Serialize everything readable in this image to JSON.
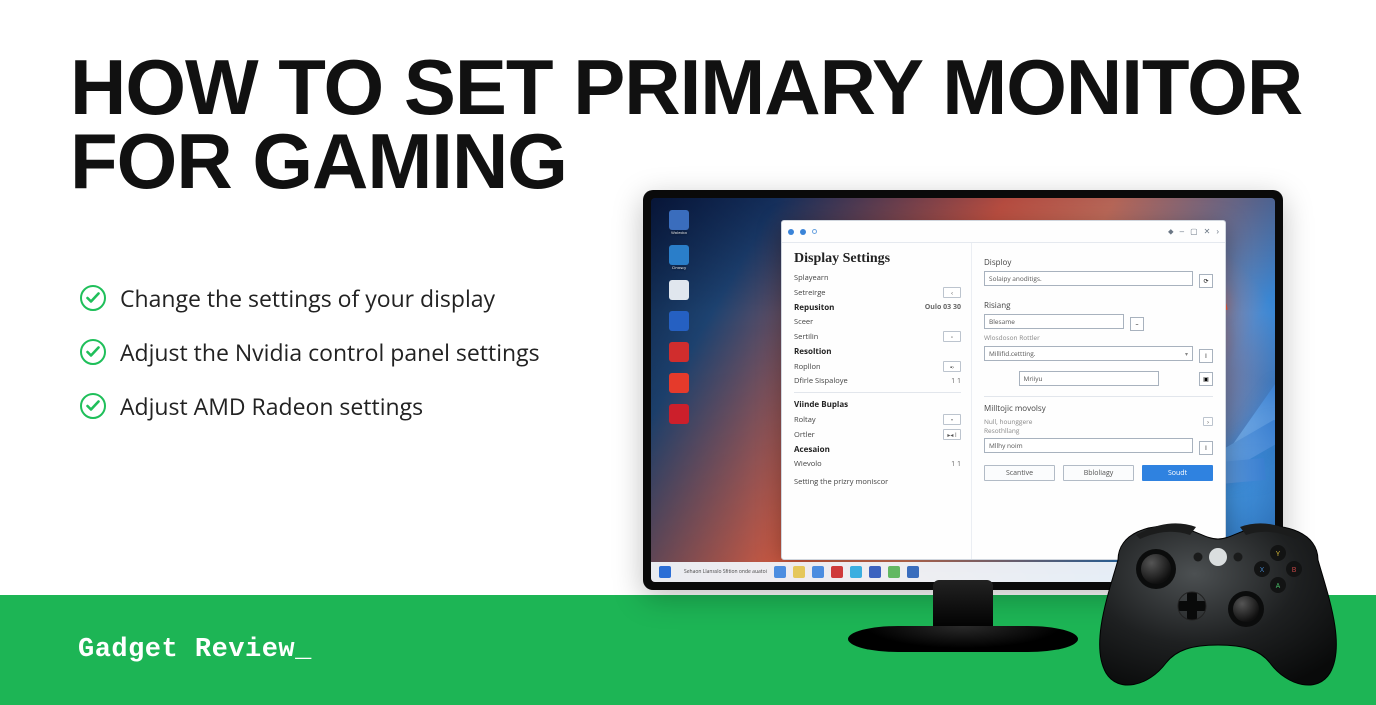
{
  "title_line1": "HOW TO SET PRIMARY MONITOR",
  "title_line2": "FOR GAMING",
  "bullets": [
    "Change the settings of your display",
    "Adjust the Nvidia control panel settings",
    "Adjust AMD Radeon settings"
  ],
  "brand": "Gadget Review_",
  "desktop_icons": [
    {
      "color": "#3a6dbd",
      "label": "Wolecko"
    },
    {
      "color": "#2a7ec9",
      "label": "Cinoscy"
    },
    {
      "color": "#e0e6ee",
      "label": ""
    },
    {
      "color": "#2560c2",
      "label": ""
    },
    {
      "color": "#d02d2d",
      "label": ""
    },
    {
      "color": "#e53a2b",
      "label": ""
    },
    {
      "color": "#cc1f2b",
      "label": ""
    }
  ],
  "taskbar_status": "Sehaon Llansslo Sfition onde auatoi",
  "settings": {
    "window_title": "Display Settings",
    "right_title": "Disploy",
    "left_items": [
      {
        "label": "Splayearn",
        "bold": false,
        "value": ""
      },
      {
        "label": "Setreirge",
        "bold": false,
        "value": "",
        "btn": "‹"
      },
      {
        "label": "Repusiton",
        "bold": true,
        "value": "Oulo 03 30"
      },
      {
        "label": "Sceer",
        "bold": false,
        "value": ""
      },
      {
        "label": "Sertilin",
        "bold": false,
        "value": "",
        "btn": "▫"
      },
      {
        "label": "Resoltion",
        "bold": true,
        "value": ""
      },
      {
        "label": "Ropllon",
        "bold": false,
        "value": "",
        "btn": "▪›"
      },
      {
        "label": "Dfirle Sispaloye",
        "bold": false,
        "value": "1 1"
      }
    ],
    "left_section2_title": "Viinde Buplas",
    "left_items2": [
      {
        "label": "Roltay",
        "bold": false,
        "value": "",
        "btn": "•"
      },
      {
        "label": "Ortler",
        "bold": false,
        "value": "",
        "btn": "▸◂ I"
      },
      {
        "label": "Acesaion",
        "bold": true,
        "value": ""
      },
      {
        "label": "Wievolo",
        "bold": false,
        "value": "1 1",
        "btn": ""
      }
    ],
    "footer": "Setting the prizry moniscor",
    "right": {
      "field1": "Solaipy anoditigs.",
      "section2": "Risiang",
      "field2": "Blesame",
      "mini_label1": "Wlosdoson Rottler",
      "field3": "Millifid.cettting.",
      "field4": "Mriiyu",
      "section3": "Milltojic movolsy",
      "tiny1": "Null, hounggere",
      "tiny2": "Resothllang",
      "field5": "Mllhy noim",
      "btn1": "Scantive",
      "btn2": "Bbloliagy",
      "btn3": "Soudt"
    }
  }
}
